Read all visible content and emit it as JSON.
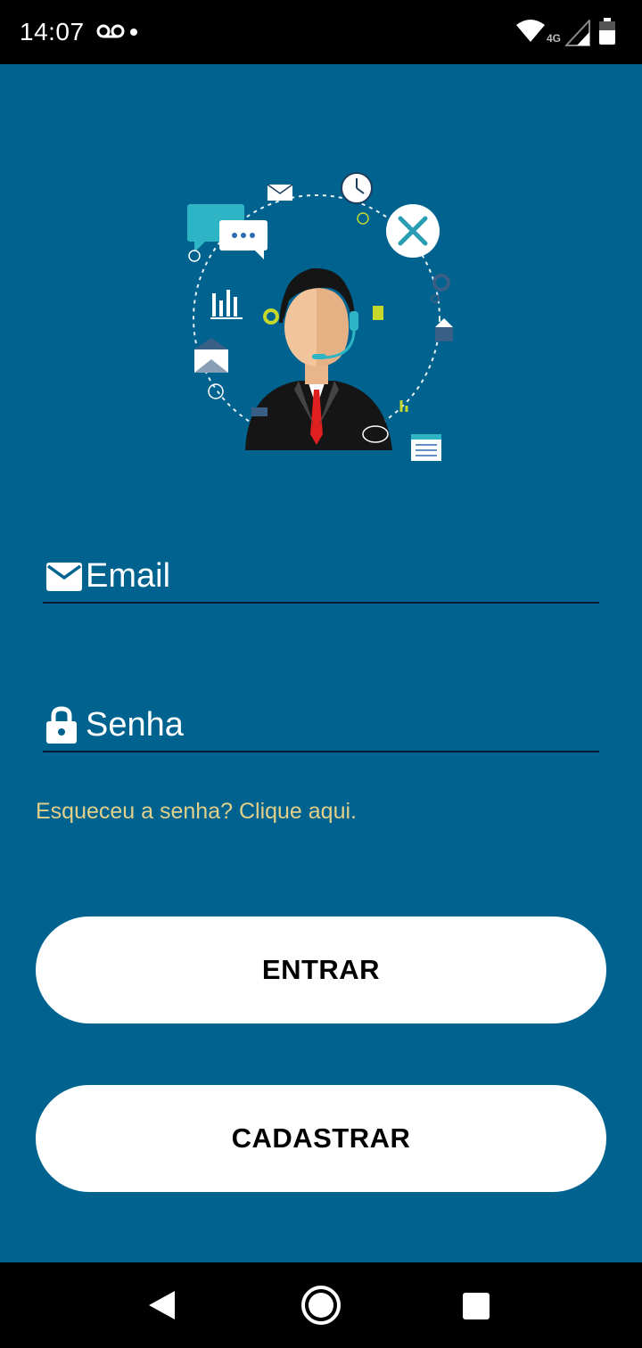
{
  "status_bar": {
    "time": "14:07",
    "network": "4G",
    "icons": [
      "voicemail-icon",
      "notification-dot",
      "wifi-icon",
      "signal-icon",
      "battery-icon"
    ]
  },
  "illustration": {
    "description_icon": "customer-support-agent-illustration"
  },
  "form": {
    "email": {
      "placeholder": "Email",
      "value": "",
      "icon": "envelope-icon"
    },
    "password": {
      "placeholder": "Senha",
      "value": "",
      "icon": "lock-icon"
    },
    "forgot_link": "Esqueceu a senha? Clique aqui."
  },
  "buttons": {
    "login": "ENTRAR",
    "register": "CADASTRAR"
  },
  "nav_bar": {
    "icons": [
      "back-icon",
      "home-icon",
      "recents-icon"
    ]
  },
  "colors": {
    "background": "#00638f",
    "link": "#e2d08a",
    "button_bg": "#ffffff",
    "underline": "#0b1a33"
  }
}
